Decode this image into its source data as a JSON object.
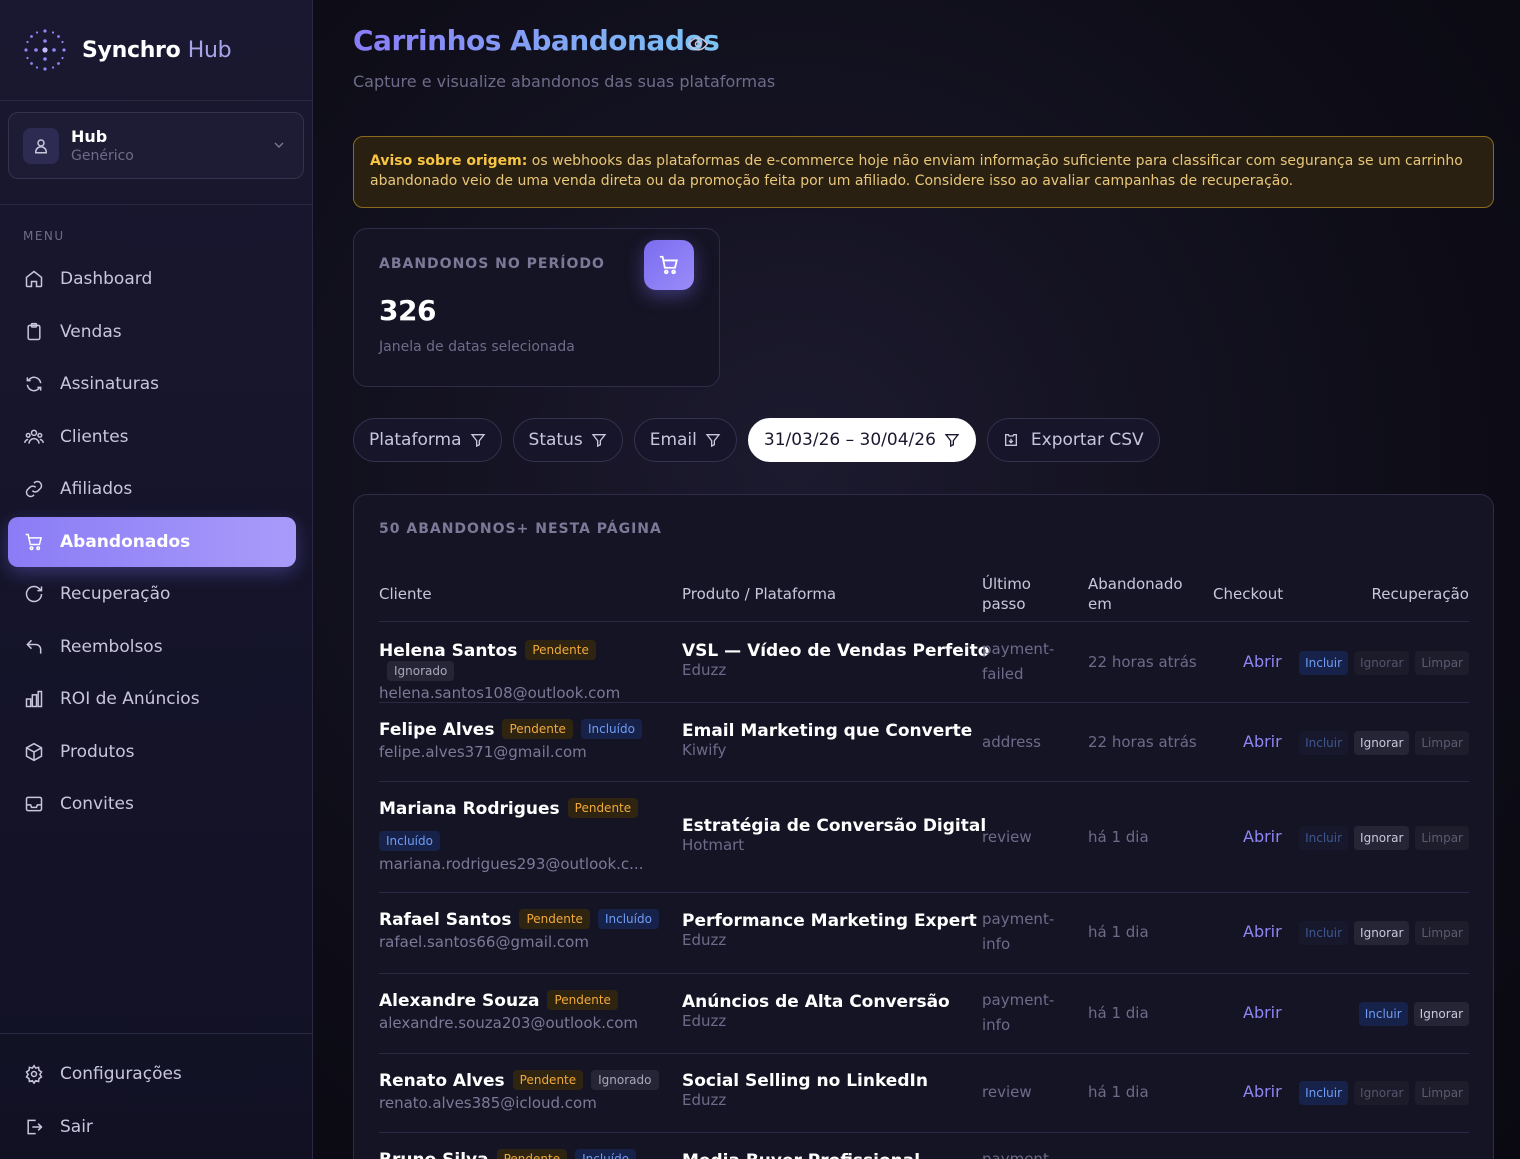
{
  "brand": {
    "name": "Synchro",
    "suffix": "Hub"
  },
  "account": {
    "title": "Hub",
    "subtitle": "Genérico"
  },
  "sidebar": {
    "menu_label": "MENU",
    "items": [
      {
        "label": "Dashboard",
        "icon": "home-icon"
      },
      {
        "label": "Vendas",
        "icon": "clipboard-icon"
      },
      {
        "label": "Assinaturas",
        "icon": "refresh-icon"
      },
      {
        "label": "Clientes",
        "icon": "users-icon"
      },
      {
        "label": "Afiliados",
        "icon": "link-icon"
      },
      {
        "label": "Abandonados",
        "icon": "cart-icon",
        "active": true
      },
      {
        "label": "Recuperação",
        "icon": "rotate-icon"
      },
      {
        "label": "Reembolsos",
        "icon": "undo-icon"
      },
      {
        "label": "ROI de Anúncios",
        "icon": "bar-chart-icon"
      },
      {
        "label": "Produtos",
        "icon": "box-icon"
      },
      {
        "label": "Convites",
        "icon": "inbox-icon"
      }
    ],
    "bottom": [
      {
        "label": "Configurações",
        "icon": "gear-icon"
      },
      {
        "label": "Sair",
        "icon": "logout-icon"
      }
    ]
  },
  "header": {
    "title": "Carrinhos Abandonados",
    "subtitle": "Capture e visualize abandonos das suas plataformas"
  },
  "notice": {
    "strong": "Aviso sobre origem:",
    "text": " os webhooks das plataformas de e-commerce hoje não enviam informação suficiente para classificar com segurança se um carrinho abandonado veio de uma venda direta ou da promoção feita por um afiliado. Considere isso ao avaliar campanhas de recuperação."
  },
  "stat": {
    "label": "ABANDONOS NO PERÍODO",
    "value": "326",
    "hint": "Janela de datas selecionada"
  },
  "filters": {
    "platform": "Plataforma",
    "status": "Status",
    "email": "Email",
    "dates": "31/03/26 – 30/04/26",
    "export": "Exportar CSV"
  },
  "table": {
    "count_label": "50 ABANDONOS+ NESTA PÁGINA",
    "headers": {
      "client": "Cliente",
      "product": "Produto / Plataforma",
      "step": "Último passo",
      "when": "Abandonado em",
      "checkout": "Checkout",
      "recovery": "Recuperação"
    },
    "rows": [
      {
        "name": "Helena Santos",
        "email": "helena.santos108@outlook.com",
        "status": "Pendente",
        "tag": "Ignorado",
        "product": "VSL — Vídeo de Vendas Perfeito",
        "platform": "Eduzz",
        "step": "payment-failed",
        "when": "22 horas atrás",
        "checkout": "Abrir",
        "actions": [
          "Incluir",
          "Ignorar",
          "Limpar"
        ]
      },
      {
        "name": "Felipe Alves",
        "email": "felipe.alves371@gmail.com",
        "status": "Pendente",
        "tag": "Incluído",
        "product": "Email Marketing que Converte",
        "platform": "Kiwify",
        "step": "address",
        "when": "22 horas atrás",
        "checkout": "Abrir",
        "actions": [
          "Incluir",
          "Ignorar",
          "Limpar"
        ]
      },
      {
        "name": "Mariana Rodrigues",
        "email": "mariana.rodrigues293@outlook.c...",
        "status": "Pendente",
        "tag": "Incluído",
        "product": "Estratégia de Conversão Digital",
        "platform": "Hotmart",
        "step": "review",
        "when": "há 1 dia",
        "checkout": "Abrir",
        "actions": [
          "Incluir",
          "Ignorar",
          "Limpar"
        ]
      },
      {
        "name": "Rafael Santos",
        "email": "rafael.santos66@gmail.com",
        "status": "Pendente",
        "tag": "Incluído",
        "product": "Performance Marketing Expert",
        "platform": "Eduzz",
        "step": "payment-info",
        "when": "há 1 dia",
        "checkout": "Abrir",
        "actions": [
          "Incluir",
          "Ignorar",
          "Limpar"
        ]
      },
      {
        "name": "Alexandre Souza",
        "email": "alexandre.souza203@outlook.com",
        "status": "Pendente",
        "tag": "",
        "product": "Anúncios de Alta Conversão",
        "platform": "Eduzz",
        "step": "payment-info",
        "when": "há 1 dia",
        "checkout": "Abrir",
        "actions": [
          "Incluir",
          "Ignorar"
        ]
      },
      {
        "name": "Renato Alves",
        "email": "renato.alves385@icloud.com",
        "status": "Pendente",
        "tag": "Ignorado",
        "product": "Social Selling no LinkedIn",
        "platform": "Eduzz",
        "step": "review",
        "when": "há 1 dia",
        "checkout": "Abrir",
        "actions": [
          "Incluir",
          "Ignorar",
          "Limpar"
        ]
      },
      {
        "name": "Bruno Silva",
        "email": "",
        "status": "Pendente",
        "tag": "Incluído",
        "product": "Media Buyer Profissional",
        "platform": "",
        "step": "payment-",
        "when": "",
        "checkout": "",
        "actions": []
      }
    ]
  }
}
